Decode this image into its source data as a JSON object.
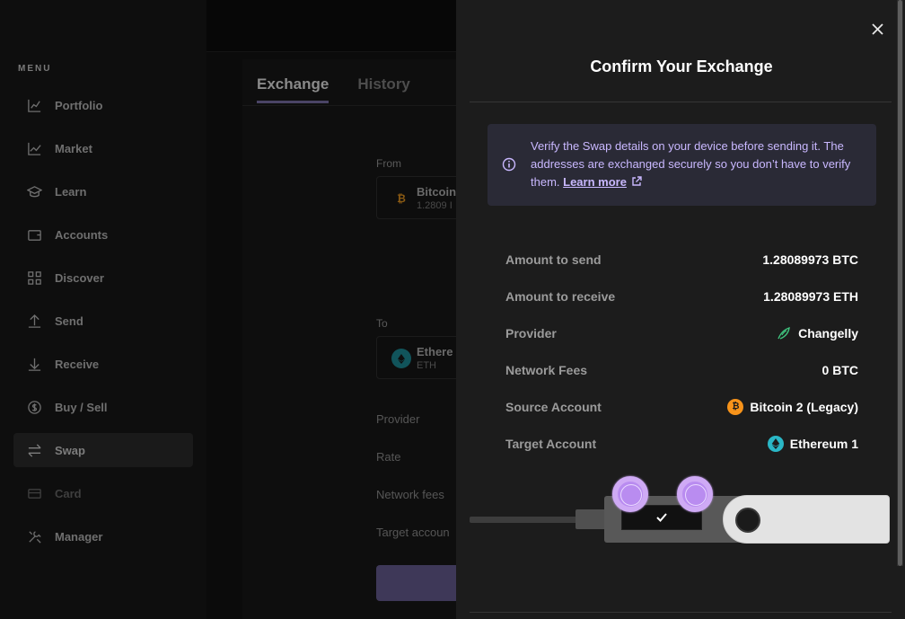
{
  "sidebar": {
    "menu_title": "MENU",
    "items": [
      {
        "label": "Portfolio",
        "icon": "portfolio-icon"
      },
      {
        "label": "Market",
        "icon": "market-icon"
      },
      {
        "label": "Learn",
        "icon": "learn-icon"
      },
      {
        "label": "Accounts",
        "icon": "wallet-icon"
      },
      {
        "label": "Discover",
        "icon": "grid-icon"
      },
      {
        "label": "Send",
        "icon": "arrow-up-icon"
      },
      {
        "label": "Receive",
        "icon": "arrow-down-icon"
      },
      {
        "label": "Buy / Sell",
        "icon": "dollar-icon"
      },
      {
        "label": "Swap",
        "icon": "swap-icon"
      },
      {
        "label": "Card",
        "icon": "card-icon"
      },
      {
        "label": "Manager",
        "icon": "tools-icon"
      }
    ]
  },
  "main": {
    "tabs": [
      {
        "label": "Exchange",
        "active": true
      },
      {
        "label": "History",
        "active": false
      }
    ],
    "from_label": "From",
    "from_account": {
      "name": "Bitcoin",
      "sub": "1.2809 I",
      "coin_symbol": "₿"
    },
    "to_label": "To",
    "to_account": {
      "name": "Ethere",
      "sub": "ETH"
    },
    "summary_labels": [
      "Provider",
      "Rate",
      "Network fees",
      "Target accoun"
    ]
  },
  "drawer": {
    "title": "Confirm Your Exchange",
    "info_text": "Verify the Swap details on your device before sending it. The addresses are exchanged securely so you don’t have to verify them.",
    "learn_more": "Learn more",
    "details": [
      {
        "label": "Amount to send",
        "value": "1.28089973 BTC",
        "icon": ""
      },
      {
        "label": "Amount to receive",
        "value": "1.28089973 ETH",
        "icon": ""
      },
      {
        "label": "Provider",
        "value": "Changelly",
        "icon": "changelly-icon"
      },
      {
        "label": "Network Fees",
        "value": "0 BTC",
        "icon": ""
      },
      {
        "label": "Source Account",
        "value": "Bitcoin 2 (Legacy)",
        "icon": "bitcoin-icon"
      },
      {
        "label": "Target Account",
        "value": "Ethereum 1",
        "icon": "ethereum-icon"
      }
    ],
    "btc_symbol": "₿"
  },
  "colors": {
    "accent_purple": "#c9b8ff",
    "info_bg": "#2a2a36",
    "bitcoin": "#f7931a",
    "ethereum": "#2ab7c6",
    "changelly": "#3fc57f"
  }
}
